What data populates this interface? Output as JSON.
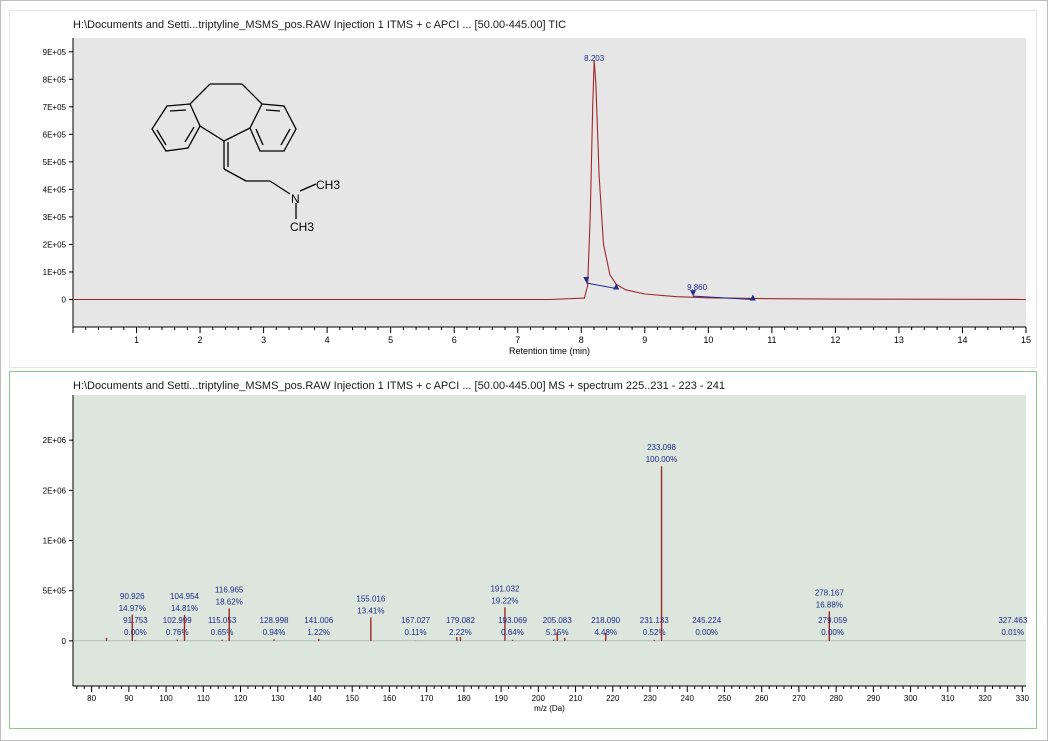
{
  "colors": {
    "trace": "#a0282a",
    "label": "#1e2a8c",
    "baseline": "#1e2a8c",
    "tic_bg": "#e6e6e6",
    "ms_bg": "#dce6dc",
    "axis": "#000000"
  },
  "tic": {
    "title": "H:\\Documents and Setti...triptyline_MSMS_pos.RAW Injection 1 ITMS + c APCI ... [50.00-445.00] TIC",
    "structure_labels": {
      "methyl_top": "CH3",
      "methyl_bottom": "CH3",
      "nitrogen": "N"
    }
  },
  "ms": {
    "title": "H:\\Documents and Setti...triptyline_MSMS_pos.RAW Injection 1 ITMS + c APCI ... [50.00-445.00] MS + spectrum 225..231 - 223 - 241"
  },
  "chart_data": [
    {
      "type": "line",
      "title": "H:\\Documents and Setti...triptyline_MSMS_pos.RAW Injection 1 ITMS + c APCI ... [50.00-445.00] TIC",
      "xlabel": "Retention time (min)",
      "ylabel": "",
      "xlim": [
        0,
        15
      ],
      "ylim": [
        -100000,
        950000
      ],
      "xticks": [
        1,
        2,
        3,
        4,
        5,
        6,
        7,
        8,
        9,
        10,
        11,
        12,
        13,
        14,
        15
      ],
      "yticks": [
        0,
        100000,
        200000,
        300000,
        400000,
        500000,
        600000,
        700000,
        800000,
        900000
      ],
      "ytick_labels": [
        "0",
        "1E+05",
        "2E+05",
        "3E+05",
        "4E+05",
        "5E+05",
        "6E+05",
        "7E+05",
        "8E+05",
        "9E+05"
      ],
      "grid": false,
      "series": [
        {
          "x": [
            0,
            2,
            4,
            6,
            7.5,
            8.05,
            8.1,
            8.14,
            8.18,
            8.203,
            8.23,
            8.28,
            8.35,
            8.45,
            8.55,
            8.7,
            9.0,
            9.5,
            10,
            11,
            12,
            13,
            14,
            15
          ],
          "y": [
            0,
            0,
            0,
            0,
            0,
            5000,
            50000,
            300000,
            700000,
            870000,
            780000,
            450000,
            200000,
            90000,
            55000,
            35000,
            20000,
            10000,
            6000,
            3000,
            1500,
            1000,
            500,
            0
          ]
        }
      ],
      "peaks": [
        {
          "rt": 8.203,
          "label": "8.203",
          "start": 8.08,
          "end": 8.55,
          "start_y": 60000,
          "end_y": 40000
        },
        {
          "rt": 9.76,
          "label": "9.860",
          "start": 9.76,
          "end": 10.7,
          "start_y": 12000,
          "end_y": 0
        }
      ]
    },
    {
      "type": "bar",
      "title": "H:\\Documents and Setti...triptyline_MSMS_pos.RAW Injection 1 ITMS + c APCI ... [50.00-445.00] MS + spectrum 225..231 - 223 - 241",
      "xlabel": "m/z (Da)",
      "ylabel": "",
      "xlim": [
        75,
        331
      ],
      "ylim": [
        -450000,
        2450000
      ],
      "xticks": [
        80,
        90,
        100,
        110,
        120,
        130,
        140,
        150,
        160,
        170,
        180,
        190,
        200,
        210,
        220,
        230,
        240,
        250,
        260,
        270,
        280,
        290,
        300,
        310,
        320,
        330
      ],
      "yticks": [
        0,
        500000,
        1000000,
        1500000,
        2000000
      ],
      "ytick_labels": [
        "0",
        "5E+05",
        "1E+06",
        "2E+06",
        "2E+06"
      ],
      "grid": false,
      "peaks": [
        {
          "mz": 84.0,
          "intensity": 30000
        },
        {
          "mz": 90.926,
          "intensity": 260000,
          "label": "90.926",
          "pct": "14.97%"
        },
        {
          "mz": 91.753,
          "intensity": 5000,
          "label": "91.753",
          "pct": "0.00%"
        },
        {
          "mz": 102.999,
          "intensity": 13000,
          "label": "102.999",
          "pct": "0.76%"
        },
        {
          "mz": 104.954,
          "intensity": 257000,
          "label": "104.954",
          "pct": "14.81%"
        },
        {
          "mz": 115.053,
          "intensity": 11000,
          "label": "115.053",
          "pct": "0.65%"
        },
        {
          "mz": 116.965,
          "intensity": 324000,
          "label": "116.965",
          "pct": "18.62%"
        },
        {
          "mz": 128.998,
          "intensity": 16000,
          "label": "128.998",
          "pct": "0.94%"
        },
        {
          "mz": 141.006,
          "intensity": 21000,
          "label": "141.006",
          "pct": "1.22%"
        },
        {
          "mz": 155.016,
          "intensity": 233000,
          "label": "155.016",
          "pct": "13.41%"
        },
        {
          "mz": 167.027,
          "intensity": 2000,
          "label": "167.027",
          "pct": "0.11%"
        },
        {
          "mz": 178.1,
          "intensity": 38000
        },
        {
          "mz": 179.082,
          "intensity": 39000,
          "label": "179.082",
          "pct": "2.22%"
        },
        {
          "mz": 191.032,
          "intensity": 334000,
          "label": "191.032",
          "pct": "19.22%"
        },
        {
          "mz": 193.069,
          "intensity": 11000,
          "label": "193.069",
          "pct": "0.64%"
        },
        {
          "mz": 204.1,
          "intensity": 12000
        },
        {
          "mz": 205.083,
          "intensity": 90000,
          "label": "205.083",
          "pct": "5.15%"
        },
        {
          "mz": 207.1,
          "intensity": 30000
        },
        {
          "mz": 218.09,
          "intensity": 78000,
          "label": "218.090",
          "pct": "4.48%"
        },
        {
          "mz": 231.133,
          "intensity": 9000,
          "label": "231.133",
          "pct": "0.52%"
        },
        {
          "mz": 233.098,
          "intensity": 1740000,
          "label": "233.098",
          "pct": "100.00%"
        },
        {
          "mz": 245.224,
          "intensity": 0,
          "label": "245.224",
          "pct": "0.00%"
        },
        {
          "mz": 278.167,
          "intensity": 294000,
          "label": "278.167",
          "pct": "16.88%"
        },
        {
          "mz": 279.059,
          "intensity": 0,
          "label": "279.059",
          "pct": "0.00%"
        },
        {
          "mz": 327.463,
          "intensity": 0,
          "label": "327.463",
          "pct": "0.01%"
        }
      ]
    }
  ]
}
